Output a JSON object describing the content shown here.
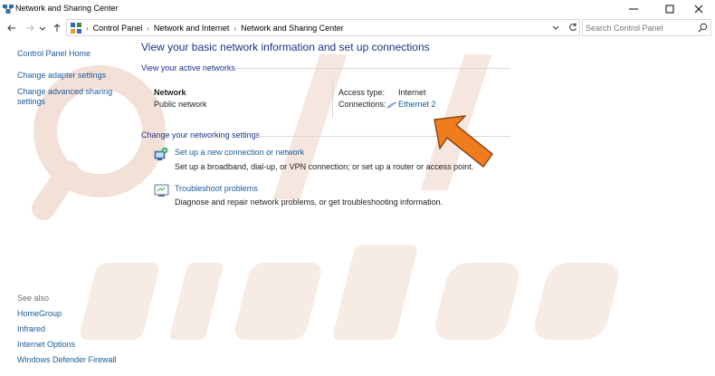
{
  "window": {
    "title": "Network and Sharing Center",
    "controls": {
      "minimize": "minimize-icon",
      "maximize": "maximize-icon",
      "close": "close-icon"
    }
  },
  "nav": {
    "back": "arrow-left-icon",
    "forward": "arrow-right-icon",
    "recent": "chevron-down-icon",
    "up": "arrow-up-icon"
  },
  "address": {
    "crumbs": [
      "Control Panel",
      "Network and Internet",
      "Network and Sharing Center"
    ]
  },
  "search": {
    "placeholder": "Search Control Panel"
  },
  "left_pane": {
    "home": "Control Panel Home",
    "links": [
      "Change adapter settings",
      "Change advanced sharing settings"
    ],
    "advanced_sharing_line1": "Change advanced sharing",
    "advanced_sharing_line2": "settings",
    "see_also_label": "See also",
    "see_also": [
      "HomeGroup",
      "Infrared",
      "Internet Options",
      "Windows Defender Firewall"
    ]
  },
  "main": {
    "heading": "View your basic network information and set up connections",
    "active_networks_label": "View your active networks",
    "network": {
      "name": "Network",
      "category": "Public network"
    },
    "access_type_label": "Access type:",
    "access_type_value": "Internet",
    "connections_label": "Connections:",
    "connection_value": "Ethernet 2",
    "change_settings_label": "Change your networking settings",
    "tasks": [
      {
        "title": "Set up a new connection or network",
        "desc": "Set up a broadband, dial-up, or VPN connection; or set up a router or access point.",
        "icon": "network-setup-icon"
      },
      {
        "title": "Troubleshoot problems",
        "desc": "Diagnose and repair network problems, or get troubleshooting information.",
        "icon": "troubleshoot-icon"
      }
    ]
  },
  "colors": {
    "link": "#1a5a99",
    "heading": "#1e3287",
    "arrow": "#f07c1e",
    "watermark": "#f3e3dc"
  }
}
